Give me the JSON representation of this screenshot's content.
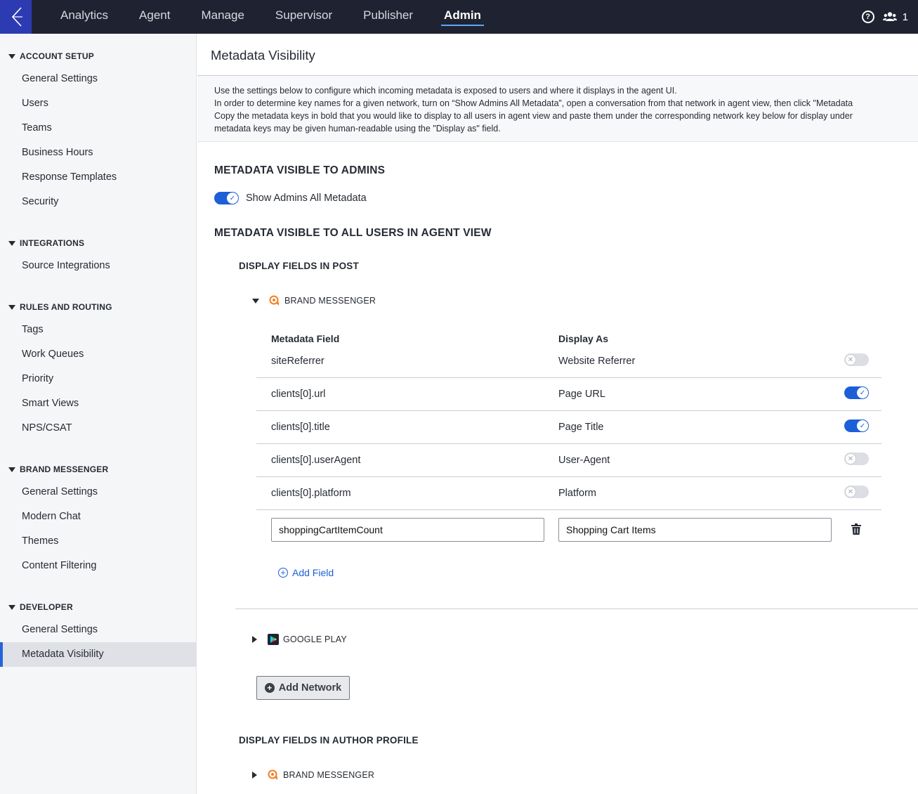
{
  "topnav": {
    "items": [
      {
        "label": "Analytics"
      },
      {
        "label": "Agent"
      },
      {
        "label": "Manage"
      },
      {
        "label": "Supervisor"
      },
      {
        "label": "Publisher"
      },
      {
        "label": "Admin",
        "active": true
      }
    ],
    "users_count": "1",
    "help_glyph": "?"
  },
  "sidebar": {
    "sections": [
      {
        "title": "ACCOUNT SETUP",
        "items": [
          "General Settings",
          "Users",
          "Teams",
          "Business Hours",
          "Response Templates",
          "Security"
        ]
      },
      {
        "title": "INTEGRATIONS",
        "items": [
          "Source Integrations"
        ]
      },
      {
        "title": "RULES AND ROUTING",
        "items": [
          "Tags",
          "Work Queues",
          "Priority",
          "Smart Views",
          "NPS/CSAT"
        ]
      },
      {
        "title": "BRAND MESSENGER",
        "items": [
          "General Settings",
          "Modern Chat",
          "Themes",
          "Content Filtering"
        ]
      },
      {
        "title": "DEVELOPER",
        "items": [
          "General Settings",
          "Metadata Visibility"
        ]
      }
    ],
    "active_item": "Metadata Visibility"
  },
  "main": {
    "title": "Metadata Visibility",
    "description": [
      "Use the settings below to configure which incoming metadata is exposed to users and where it displays in the agent UI.",
      "In order to determine key names for a given network, turn on “Show Admins All Metadata”, open a conversation from that network in agent view, then click \"Metadata",
      "Copy the metadata keys in bold that you would like to display to all users in agent view and paste them under the corresponding network key below for display under",
      "metadata keys may be given human-readable using the \"Display as\" field."
    ],
    "admins_heading": "METADATA VISIBLE TO ADMINS",
    "admins_toggle_label": "Show Admins All Metadata",
    "admins_toggle_on": true,
    "all_users_heading": "METADATA VISIBLE TO ALL USERS IN AGENT VIEW",
    "post_heading": "DISPLAY FIELDS IN POST",
    "post_networks": [
      {
        "name": "BRAND MESSENGER",
        "expanded": true,
        "icon": "brand-messenger-icon"
      },
      {
        "name": "GOOGLE PLAY",
        "expanded": false,
        "icon": "google-play-icon"
      }
    ],
    "columns": {
      "field": "Metadata Field",
      "display": "Display As"
    },
    "rows": [
      {
        "field": "siteReferrer",
        "display": "Website Referrer",
        "enabled": false
      },
      {
        "field": "clients[0].url",
        "display": "Page URL",
        "enabled": true
      },
      {
        "field": "clients[0].title",
        "display": "Page Title",
        "enabled": true
      },
      {
        "field": "clients[0].userAgent",
        "display": "User-Agent",
        "enabled": false
      },
      {
        "field": "clients[0].platform",
        "display": "Platform",
        "enabled": false
      }
    ],
    "new_row": {
      "field_value": "shoppingCartItemCount",
      "display_value": "Shopping Cart Items"
    },
    "add_field_label": "Add Field",
    "add_network_label": "Add Network",
    "author_heading": "DISPLAY FIELDS IN AUTHOR PROFILE",
    "author_networks": [
      {
        "name": "BRAND MESSENGER",
        "expanded": false,
        "icon": "brand-messenger-icon"
      }
    ]
  },
  "colors": {
    "accent": "#1d5fd6",
    "topbar": "#1f2331",
    "logo_bg": "#2d3bb3",
    "brand_orange": "#f07f22"
  }
}
